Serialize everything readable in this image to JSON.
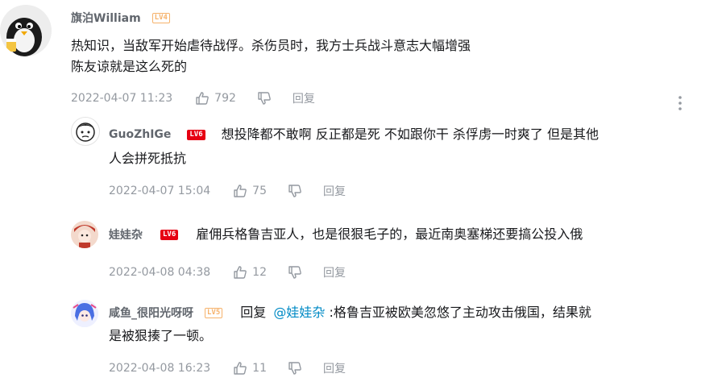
{
  "colors": {
    "accent_link": "#008ac5",
    "meta_text": "#9499a0",
    "name_text": "#61666d",
    "badge_red": "#e60012",
    "badge_orange": "#f6b26b"
  },
  "root_comment": {
    "username": "旗泊William",
    "level": "LV4",
    "lines": [
      "热知识，当敌军开始虐待战俘。杀伤员时，我方士兵战斗意志大幅增强",
      "陈友谅就是这么死的"
    ],
    "time": "2022-04-07 11:23",
    "likes": "792",
    "reply_label": "回复",
    "more_icon": "more-vertical-icon"
  },
  "replies": [
    {
      "username": "GuoZhIGe",
      "level": "LV6",
      "text_line1": "想投降都不敢啊 反正都是死 不如跟你干 杀俘虏一时爽了 但是其他",
      "text_line2": "人会拼死抵抗",
      "time": "2022-04-07 15:04",
      "likes": "75",
      "reply_label": "回复"
    },
    {
      "username": "娃娃杂",
      "level": "LV6",
      "text_line1": "雇佣兵格鲁吉亚人，也是很狠毛子的，最近南奥塞梯还要搞公投入俄",
      "time": "2022-04-08 04:38",
      "likes": "12",
      "reply_label": "回复"
    },
    {
      "username": "咸鱼_很阳光呀呀",
      "level": "LV5",
      "reply_prefix": "回复",
      "at_user": "@娃娃杂",
      "text_after_at": " :格鲁吉亚被欧美忽悠了主动攻击俄国，结果就",
      "text_line2": "是被狠揍了一顿。",
      "time": "2022-04-08 16:23",
      "likes": "11",
      "reply_label": "回复"
    }
  ]
}
